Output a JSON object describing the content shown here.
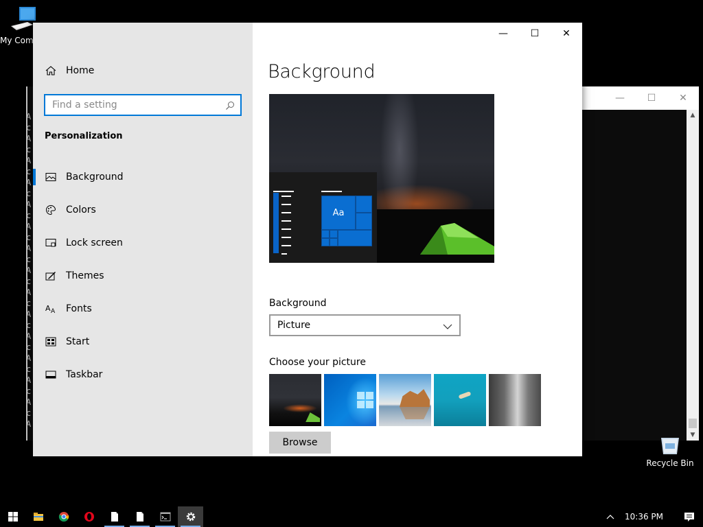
{
  "desktop": {
    "my_computer_label": "My Computer",
    "recycle_bin_label": "Recycle Bin"
  },
  "console": {
    "chars": [
      "A",
      "c",
      "A",
      "c",
      "A",
      "c",
      "A",
      "c",
      "A",
      "c",
      "A",
      "c",
      "A",
      "c",
      "A",
      "c",
      "A",
      "c",
      "A",
      "c",
      "A",
      "c",
      "A",
      "c",
      "A",
      "c",
      "A",
      "c",
      "A"
    ],
    "minimize_glyph": "—",
    "maximize_glyph": "☐",
    "close_glyph": "✕"
  },
  "settings": {
    "window": {
      "minimize_glyph": "—",
      "maximize_glyph": "☐",
      "close_glyph": "✕"
    },
    "sidebar": {
      "home_label": "Home",
      "search_placeholder": "Find a setting",
      "section_title": "Personalization",
      "items": [
        {
          "label": "Background",
          "icon": "picture-icon",
          "active": true
        },
        {
          "label": "Colors",
          "icon": "palette-icon",
          "active": false
        },
        {
          "label": "Lock screen",
          "icon": "lock-screen-icon",
          "active": false
        },
        {
          "label": "Themes",
          "icon": "themes-icon",
          "active": false
        },
        {
          "label": "Fonts",
          "icon": "fonts-icon",
          "active": false
        },
        {
          "label": "Start",
          "icon": "start-icon",
          "active": false
        },
        {
          "label": "Taskbar",
          "icon": "taskbar-icon",
          "active": false
        }
      ]
    },
    "main": {
      "title": "Background",
      "preview_tile_text": "Aa",
      "background_label": "Background",
      "background_value": "Picture",
      "choose_label": "Choose your picture",
      "browse_label": "Browse"
    }
  },
  "taskbar": {
    "time": "10:36 PM",
    "apps": [
      "start-icon",
      "file-explorer-icon",
      "chrome-icon",
      "opera-icon",
      "document-icon",
      "document-icon",
      "console-icon",
      "settings-gear-icon"
    ]
  },
  "colors": {
    "accent": "#0078d7",
    "sidebar_bg": "#e6e6e6",
    "tile_blue": "#0a6ed1"
  }
}
